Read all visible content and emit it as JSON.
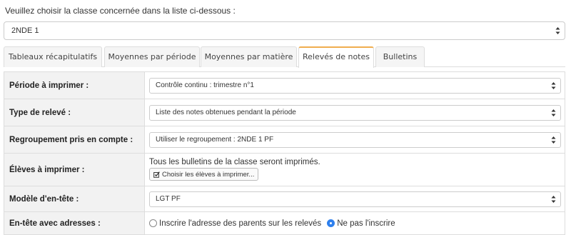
{
  "intro_text": "Veuillez choisir la classe concernée dans la liste ci-dessous :",
  "class_select": {
    "value": "2NDE 1"
  },
  "tabs": [
    {
      "label": "Tableaux récapitulatifs",
      "active": false
    },
    {
      "label": "Moyennes par période",
      "active": false
    },
    {
      "label": "Moyennes par matière",
      "active": false
    },
    {
      "label": "Relevés de notes",
      "active": true
    },
    {
      "label": "Bulletins",
      "active": false
    }
  ],
  "form": {
    "periode": {
      "label": "Période à imprimer :",
      "value": "Contrôle continu : trimestre n°1"
    },
    "type_releve": {
      "label": "Type de relevé :",
      "value": "Liste des notes obtenues pendant la période"
    },
    "regroupement": {
      "label": "Regroupement pris en compte :",
      "value": "Utiliser le regroupement : 2NDE 1 PF"
    },
    "eleves": {
      "label": "Élèves à imprimer :",
      "text": "Tous les bulletins de la classe seront imprimés.",
      "button": "Choisir les élèves à imprimer..."
    },
    "modele": {
      "label": "Modèle d'en-tête :",
      "value": "LGT PF"
    },
    "entete": {
      "label": "En-tête avec adresses :",
      "option1": "Inscrire l'adresse des parents sur les relevés",
      "option2": "Ne pas l'inscrire",
      "selected": "option2"
    }
  },
  "colors": {
    "active_tab_accent": "#f0ad4e",
    "radio_checked": "#2f80ed"
  }
}
